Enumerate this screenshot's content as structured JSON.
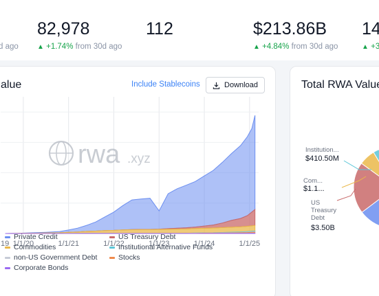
{
  "stats": [
    {
      "value": "",
      "change": "",
      "period": "d ago"
    },
    {
      "value": "82,978",
      "change": "+1.74%",
      "period": "from 30d ago"
    },
    {
      "value": "112",
      "change": "",
      "period": ""
    },
    {
      "value": "$213.86B",
      "change": "+4.84%",
      "period": "from 30d ago"
    },
    {
      "value": "14",
      "change": "+3",
      "period": ""
    }
  ],
  "main_card": {
    "title": "alue",
    "stablecoins_link": "Include Stablecoins",
    "download_label": "Download",
    "watermark_word": "rwa",
    "watermark_suffix": ".xyz"
  },
  "side_card": {
    "title": "Total RWA Value"
  },
  "colors": {
    "private_credit": "#6b8ef0",
    "us_treasury": "#c96a6a",
    "commodities": "#eab84a",
    "institutional_alt": "#5bc6d8",
    "non_us_gov": "#c6cbd6",
    "stocks": "#ef8a4c",
    "corporate_bonds": "#9b6bf2",
    "accent": "#3b82f6",
    "positive": "#16a34a"
  },
  "legend": [
    {
      "label": "Private Credit",
      "color_key": "private_credit"
    },
    {
      "label": "US Treasury Debt",
      "color_key": "us_treasury"
    },
    {
      "label": "Commodities",
      "color_key": "commodities"
    },
    {
      "label": "Institutional Alternative Funds",
      "color_key": "institutional_alt"
    },
    {
      "label": "non-US Government Debt",
      "color_key": "non_us_gov"
    },
    {
      "label": "Stocks",
      "color_key": "stocks"
    },
    {
      "label": "Corporate Bonds",
      "color_key": "corporate_bonds"
    }
  ],
  "chart_data": [
    {
      "type": "area",
      "stacked": true,
      "x_tick_labels": [
        "19",
        "1/1/20",
        "1/1/21",
        "1/1/22",
        "1/1/23",
        "1/1/24",
        "1/1/25"
      ],
      "x": [
        2019.6,
        2019.9,
        2020.2,
        2020.5,
        2020.8,
        2021.0,
        2021.2,
        2021.4,
        2021.6,
        2021.8,
        2022.0,
        2022.2,
        2022.4,
        2022.6,
        2022.8,
        2023.0,
        2023.2,
        2023.4,
        2023.6,
        2023.8,
        2024.0,
        2024.2,
        2024.4,
        2024.6,
        2024.8,
        2024.95,
        2025.05,
        2025.12
      ],
      "series": [
        {
          "name": "Private Credit",
          "color_key": "private_credit",
          "values": [
            0.0,
            0.1,
            0.3,
            0.5,
            0.8,
            1.5,
            2.5,
            4.0,
            6.0,
            9.0,
            12.0,
            16.0,
            19.5,
            20.0,
            20.5,
            12.0,
            23.0,
            26.0,
            28.0,
            30.0,
            33.0,
            36.0,
            40.0,
            44.0,
            48.0,
            52.0,
            55.0,
            62.0
          ]
        },
        {
          "name": "US Treasury Debt",
          "color_key": "us_treasury",
          "values": [
            0.0,
            0.0,
            0.0,
            0.0,
            0.0,
            0.0,
            0.0,
            0.0,
            0.0,
            0.0,
            0.0,
            0.0,
            0.1,
            0.1,
            0.1,
            0.2,
            0.4,
            0.6,
            0.8,
            1.0,
            1.5,
            2.0,
            3.0,
            4.5,
            5.5,
            7.0,
            9.0,
            10.5
          ]
        },
        {
          "name": "Commodities",
          "color_key": "commodities",
          "values": [
            0.0,
            0.1,
            0.2,
            0.3,
            0.5,
            0.8,
            1.0,
            1.3,
            1.5,
            1.8,
            2.0,
            2.3,
            2.4,
            2.5,
            2.5,
            2.6,
            2.7,
            2.8,
            2.8,
            2.9,
            3.0,
            3.1,
            3.2,
            3.3,
            3.4,
            3.5,
            3.6,
            3.7
          ]
        },
        {
          "name": "Institutional Alternative Funds",
          "color_key": "institutional_alt",
          "values": [
            0.0,
            0.0,
            0.0,
            0.0,
            0.0,
            0.0,
            0.0,
            0.0,
            0.0,
            0.0,
            0.0,
            0.0,
            0.0,
            0.0,
            0.0,
            0.0,
            0.0,
            0.0,
            0.05,
            0.1,
            0.1,
            0.15,
            0.2,
            0.25,
            0.3,
            0.35,
            0.4,
            0.41
          ]
        },
        {
          "name": "non-US Government Debt",
          "color_key": "non_us_gov",
          "values": [
            0.0,
            0.0,
            0.0,
            0.0,
            0.0,
            0.0,
            0.0,
            0.0,
            0.0,
            0.0,
            0.0,
            0.0,
            0.0,
            0.0,
            0.0,
            0.0,
            0.0,
            0.0,
            0.05,
            0.1,
            0.1,
            0.1,
            0.15,
            0.2,
            0.2,
            0.25,
            0.3,
            0.3
          ]
        },
        {
          "name": "Stocks",
          "color_key": "stocks",
          "values": [
            0.0,
            0.0,
            0.0,
            0.0,
            0.0,
            0.0,
            0.05,
            0.1,
            0.1,
            0.1,
            0.1,
            0.1,
            0.1,
            0.1,
            0.1,
            0.1,
            0.1,
            0.1,
            0.1,
            0.15,
            0.2,
            0.2,
            0.25,
            0.3,
            0.4,
            0.5,
            0.6,
            0.7
          ]
        },
        {
          "name": "Corporate Bonds",
          "color_key": "corporate_bonds",
          "values": [
            0.0,
            0.0,
            0.0,
            0.0,
            0.0,
            0.0,
            0.0,
            0.0,
            0.0,
            0.0,
            0.0,
            0.0,
            0.0,
            0.0,
            0.0,
            0.0,
            0.0,
            0.0,
            0.0,
            0.0,
            0.05,
            0.05,
            0.1,
            0.1,
            0.1,
            0.15,
            0.2,
            0.2
          ]
        }
      ],
      "ylim": [
        0,
        90
      ],
      "grid": true
    },
    {
      "type": "pie",
      "title": "Total RWA Value",
      "slices": [
        {
          "label": "Private Credit",
          "color_key": "private_credit",
          "value": 12.0
        },
        {
          "label": "US Treasury Debt",
          "color_key": "us_treasury",
          "value_label": "$3.50B",
          "value": 3.5
        },
        {
          "label": "Commodities",
          "color_key": "commodities",
          "value_label": "$1.1...",
          "value": 1.1
        },
        {
          "label": "Institutional Alternative Funds",
          "color_key": "institutional_alt",
          "value_label": "$410.50M",
          "value": 0.41
        },
        {
          "label": "Stocks",
          "color_key": "stocks",
          "value": 0.1
        },
        {
          "label": "non-US Government Debt",
          "color_key": "non_us_gov",
          "value": 0.1
        },
        {
          "label": "Corporate Bonds",
          "color_key": "corporate_bonds",
          "value": 0.06
        }
      ],
      "visible_labels": [
        {
          "short": "Institution...",
          "value_label": "$410.50M"
        },
        {
          "short": "Com...",
          "value_label": "$1.1..."
        },
        {
          "short": "US Treasury Debt",
          "value_label": "$3.50B"
        }
      ]
    }
  ]
}
